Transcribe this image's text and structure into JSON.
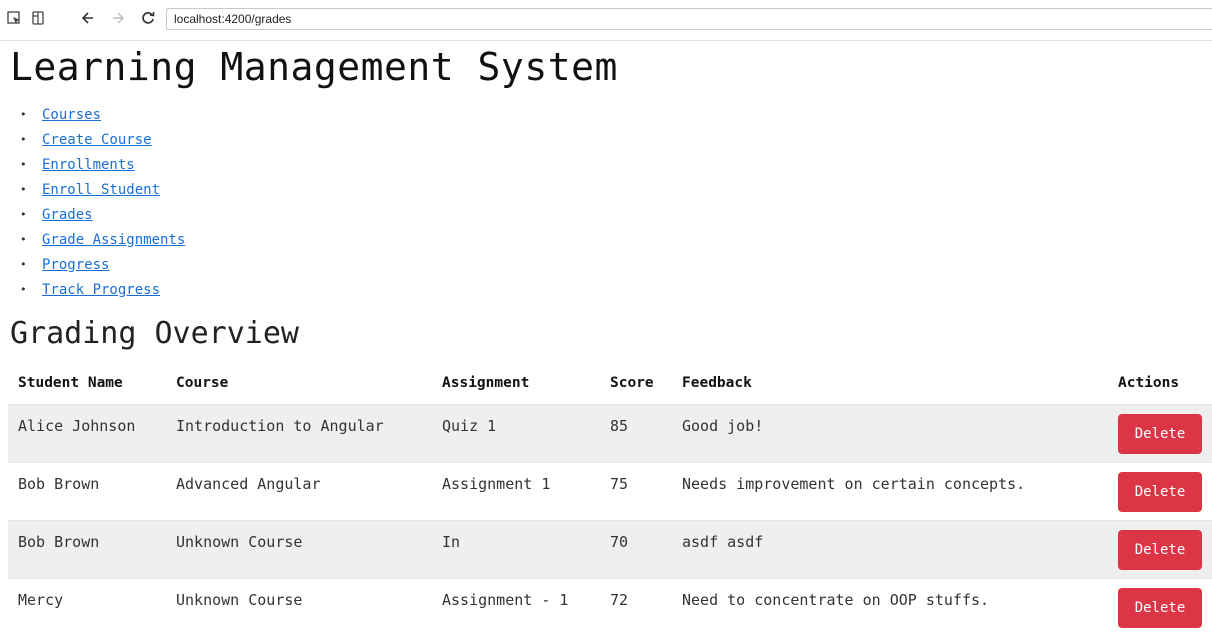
{
  "browser": {
    "url": "localhost:4200/grades"
  },
  "app": {
    "title": "Learning Management System"
  },
  "nav": {
    "items": [
      {
        "label": "Courses"
      },
      {
        "label": "Create Course"
      },
      {
        "label": "Enrollments"
      },
      {
        "label": "Enroll Student"
      },
      {
        "label": "Grades"
      },
      {
        "label": "Grade Assignments"
      },
      {
        "label": "Progress"
      },
      {
        "label": "Track Progress"
      }
    ]
  },
  "grading": {
    "title": "Grading Overview",
    "columns": {
      "student": "Student Name",
      "course": "Course",
      "assignment": "Assignment",
      "score": "Score",
      "feedback": "Feedback",
      "actions": "Actions"
    },
    "rows": [
      {
        "student": "Alice Johnson",
        "course": "Introduction to Angular",
        "assignment": "Quiz 1",
        "score": "85",
        "feedback": "Good job!",
        "action": "Delete"
      },
      {
        "student": "Bob Brown",
        "course": "Advanced Angular",
        "assignment": "Assignment 1",
        "score": "75",
        "feedback": "Needs improvement on certain concepts.",
        "action": "Delete"
      },
      {
        "student": "Bob Brown",
        "course": "Unknown Course",
        "assignment": "In",
        "score": "70",
        "feedback": "asdf asdf",
        "action": "Delete"
      },
      {
        "student": "Mercy",
        "course": "Unknown Course",
        "assignment": "Assignment - 1",
        "score": "72",
        "feedback": "Need to concentrate on OOP stuffs.",
        "action": "Delete"
      }
    ]
  },
  "colors": {
    "link": "#1a6fd4",
    "delete_button": "#dc3545",
    "row_stripe": "#efefef"
  }
}
